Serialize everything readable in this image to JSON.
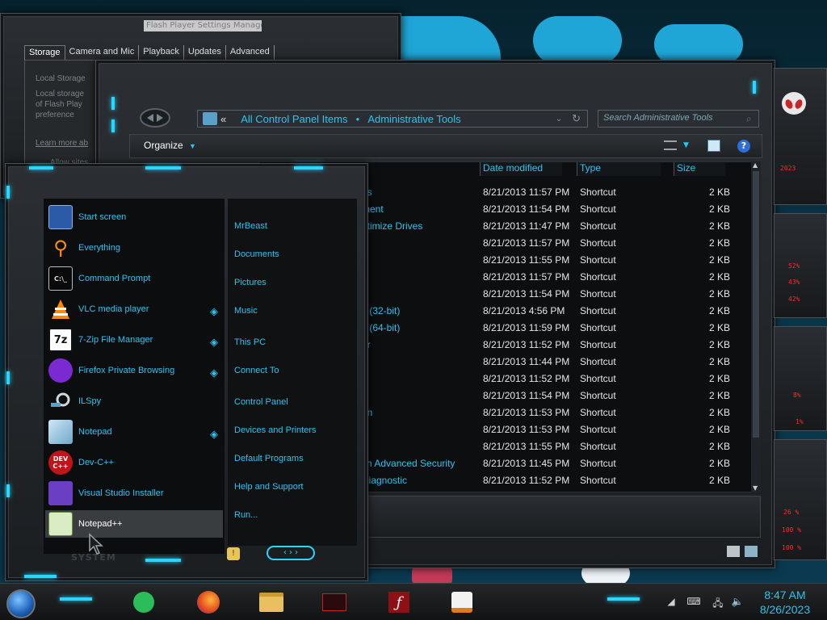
{
  "flash": {
    "title": "Flash Player Settings Manager",
    "tabs": [
      "Storage",
      "Camera and Mic",
      "Playback",
      "Updates",
      "Advanced"
    ],
    "body_lines": [
      "Local Storage",
      "Local storage",
      "of Flash Play",
      "preference"
    ],
    "link": "Learn more ab",
    "allow": "Allow sites"
  },
  "explorer": {
    "breadcrumb": {
      "back": "«",
      "item1": "All Control Panel Items",
      "separator": "●",
      "item2": "Administrative Tools"
    },
    "search_placeholder": "Search Administrative Tools",
    "organize_label": "Organize",
    "columns": [
      "Date modified",
      "Type",
      "Size"
    ],
    "rows": [
      {
        "name": "es",
        "date": "8/21/2013 11:57 PM",
        "type": "Shortcut",
        "size": "2 KB"
      },
      {
        "name": "ment",
        "date": "8/21/2013 11:54 PM",
        "type": "Shortcut",
        "size": "2 KB"
      },
      {
        "name": "ptimize Drives",
        "date": "8/21/2013 11:47 PM",
        "type": "Shortcut",
        "size": "2 KB"
      },
      {
        "name": "",
        "date": "8/21/2013 11:57 PM",
        "type": "Shortcut",
        "size": "2 KB"
      },
      {
        "name": "",
        "date": "8/21/2013 11:55 PM",
        "type": "Shortcut",
        "size": "2 KB"
      },
      {
        "name": "",
        "date": "8/21/2013 11:57 PM",
        "type": "Shortcut",
        "size": "2 KB"
      },
      {
        "name": "",
        "date": "8/21/2013 11:54 PM",
        "type": "Shortcut",
        "size": "2 KB"
      },
      {
        "name": "s (32-bit)",
        "date": "8/21/2013 4:56 PM",
        "type": "Shortcut",
        "size": "2 KB"
      },
      {
        "name": "s (64-bit)",
        "date": "8/21/2013 11:59 PM",
        "type": "Shortcut",
        "size": "2 KB"
      },
      {
        "name": "or",
        "date": "8/21/2013 11:52 PM",
        "type": "Shortcut",
        "size": "2 KB"
      },
      {
        "name": "",
        "date": "8/21/2013 11:44 PM",
        "type": "Shortcut",
        "size": "2 KB"
      },
      {
        "name": "",
        "date": "8/21/2013 11:52 PM",
        "type": "Shortcut",
        "size": "2 KB"
      },
      {
        "name": "",
        "date": "8/21/2013 11:54 PM",
        "type": "Shortcut",
        "size": "2 KB"
      },
      {
        "name": "on",
        "date": "8/21/2013 11:53 PM",
        "type": "Shortcut",
        "size": "2 KB"
      },
      {
        "name": "",
        "date": "8/21/2013 11:53 PM",
        "type": "Shortcut",
        "size": "2 KB"
      },
      {
        "name": "",
        "date": "8/21/2013 11:55 PM",
        "type": "Shortcut",
        "size": "2 KB"
      },
      {
        "name": "ith Advanced Security",
        "date": "8/21/2013 11:45 PM",
        "type": "Shortcut",
        "size": "2 KB"
      },
      {
        "name": "Diagnostic",
        "date": "8/21/2013 11:52 PM",
        "type": "Shortcut",
        "size": "2 KB"
      }
    ]
  },
  "gadgets": {
    "readouts": [
      "2023",
      "52%",
      "43%",
      "42%",
      "8%",
      "1%",
      "26 %",
      "100 %",
      "100 %"
    ]
  },
  "start_menu": {
    "apps": [
      {
        "label": "Start screen",
        "icon": "start-screen-icon"
      },
      {
        "label": "Everything",
        "icon": "magnifier-icon"
      },
      {
        "label": "Command Prompt",
        "icon": "console-icon"
      },
      {
        "label": "VLC media player",
        "icon": "vlc-cone-icon"
      },
      {
        "label": "7-Zip File Manager",
        "icon": "7zip-icon"
      },
      {
        "label": "Firefox Private Browsing",
        "icon": "firefox-private-icon"
      },
      {
        "label": "ILSpy",
        "icon": "ilspy-icon"
      },
      {
        "label": "Notepad",
        "icon": "notepad-icon"
      },
      {
        "label": "Dev-C++",
        "icon": "devcpp-icon"
      },
      {
        "label": "Visual Studio Installer",
        "icon": "vs-installer-icon"
      },
      {
        "label": "Notepad++",
        "icon": "notepadpp-icon"
      }
    ],
    "icon_text": {
      "cmd": "C:\\_",
      "zip": "7z",
      "dev": "DEV C++"
    },
    "places": [
      "MrBeast",
      "Documents",
      "Pictures",
      "Music",
      "This PC",
      "Connect To",
      "Control Panel",
      "Devices and Printers",
      "Default Programs",
      "Help and Support",
      "Run..."
    ],
    "system_label": "SYSTEM"
  },
  "taskbar": {
    "time": "8:47 AM",
    "date": "8/26/2023"
  }
}
